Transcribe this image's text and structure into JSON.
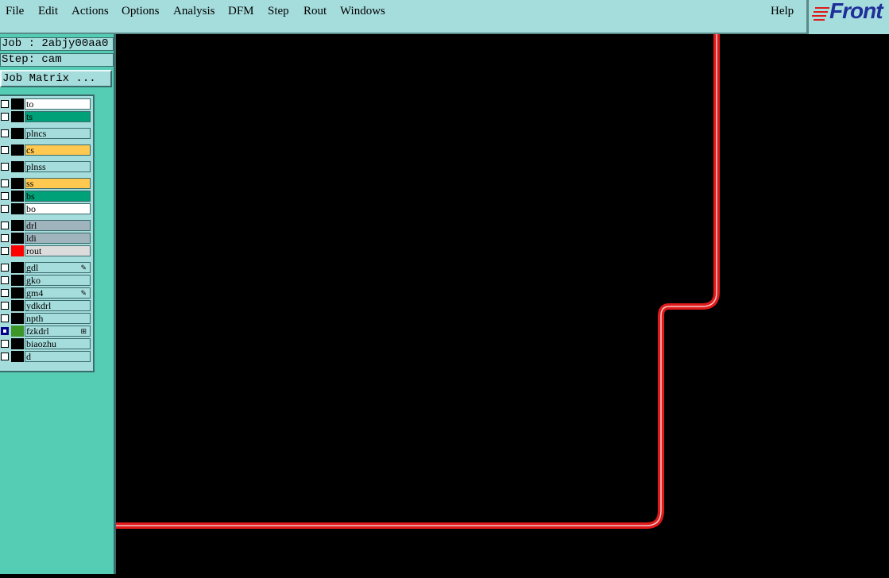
{
  "menu": {
    "items": [
      "File",
      "Edit",
      "Actions",
      "Options",
      "Analysis",
      "DFM",
      "Step",
      "Rout",
      "Windows"
    ],
    "help": "Help"
  },
  "logo": {
    "text": "Front"
  },
  "job": {
    "job_label": "Job : 2abjy00aa0",
    "step_label": "Step: cam",
    "matrix_button": "Job Matrix ..."
  },
  "layers": [
    {
      "name": "to",
      "color": "#ffffff",
      "swatch": "#000000"
    },
    {
      "name": "ts",
      "color": "#00a078",
      "swatch": "#000000"
    },
    {
      "name": "plncs",
      "color": "#a5dcdc",
      "swatch": "#000000"
    },
    {
      "name": "cs",
      "color": "#ffc850",
      "swatch": "#000000"
    },
    {
      "name": "plnss",
      "color": "#a5dcdc",
      "swatch": "#000000"
    },
    {
      "name": "ss",
      "color": "#ffc850",
      "swatch": "#000000"
    },
    {
      "name": "bs",
      "color": "#00a078",
      "swatch": "#000000"
    },
    {
      "name": "bo",
      "color": "#ffffff",
      "swatch": "#000000"
    },
    {
      "name": "drl",
      "color": "#a0b4be",
      "swatch": "#000000"
    },
    {
      "name": "ldi",
      "color": "#a0b4be",
      "swatch": "#000000"
    },
    {
      "name": "rout",
      "color": "#dcdcdc",
      "swatch": "#ff0000"
    },
    {
      "name": "gdl",
      "color": "#a5dcdc",
      "swatch": "#000000",
      "mark": "pen"
    },
    {
      "name": "gko",
      "color": "#a5dcdc",
      "swatch": "#000000"
    },
    {
      "name": "gm4",
      "color": "#a5dcdc",
      "swatch": "#000000",
      "mark": "pen"
    },
    {
      "name": "ydkdrl",
      "color": "#a5dcdc",
      "swatch": "#000000"
    },
    {
      "name": "npth",
      "color": "#a5dcdc",
      "swatch": "#000000"
    },
    {
      "name": "fzkdrl",
      "color": "#a5dcdc",
      "swatch": "#3c9628",
      "mark": "grid",
      "checked": true
    },
    {
      "name": "biaozhu",
      "color": "#a5dcdc",
      "swatch": "#000000"
    },
    {
      "name": "d",
      "color": "#a5dcdc",
      "swatch": "#000000"
    }
  ],
  "colors": {
    "accent_red": "#e01a1a",
    "trace_core": "#f0c8c8",
    "panel_teal": "#55cdb4",
    "menu_bg": "#a5dcdc"
  }
}
